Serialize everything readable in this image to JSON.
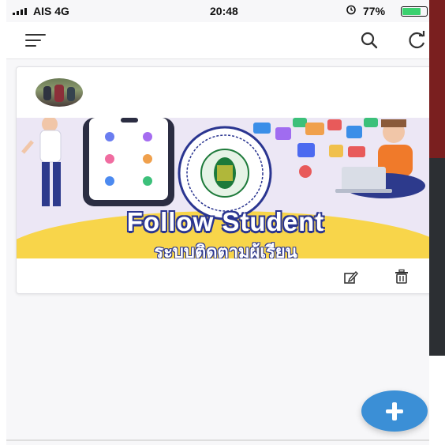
{
  "status_bar": {
    "carrier": "AIS  4G",
    "time": "20:48",
    "alarm_icon": "alarm-clock-icon",
    "battery_percent": "77%",
    "battery_level": 0.77,
    "battery_color": "#3bd16f"
  },
  "app_bar": {
    "menu_icon": "menu-icon",
    "search_icon": "search-icon",
    "refresh_icon": "refresh-icon"
  },
  "card": {
    "banner_title": "Follow Student",
    "banner_subtitle": "ระบบติดตามผู้เรียน",
    "actions": {
      "edit_icon": "edit-icon",
      "delete_icon": "trash-icon"
    }
  },
  "fab": {
    "icon": "plus-icon",
    "color": "#3b8fd6"
  }
}
